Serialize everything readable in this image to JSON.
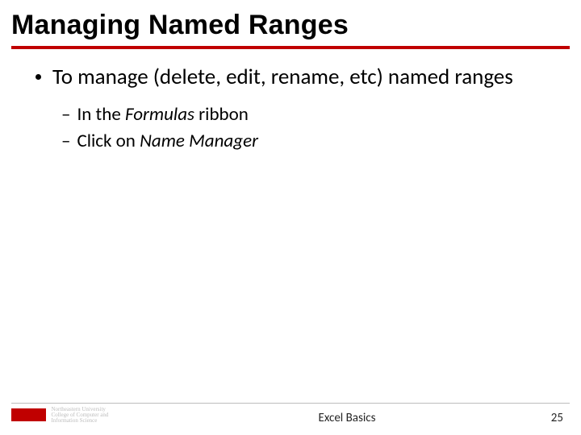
{
  "title": "Managing Named Ranges",
  "bullet1": "To manage (delete, edit, rename, etc) named ranges",
  "sub1_pre": "In the ",
  "sub1_italic": "Formulas",
  "sub1_post": " ribbon",
  "sub2_pre": "Click on ",
  "sub2_italic": "Name Manager",
  "footer_logo_line1": "Northeastern University",
  "footer_logo_line2": "College of Computer and Information Science",
  "footer_center": "Excel Basics",
  "footer_page": "25"
}
